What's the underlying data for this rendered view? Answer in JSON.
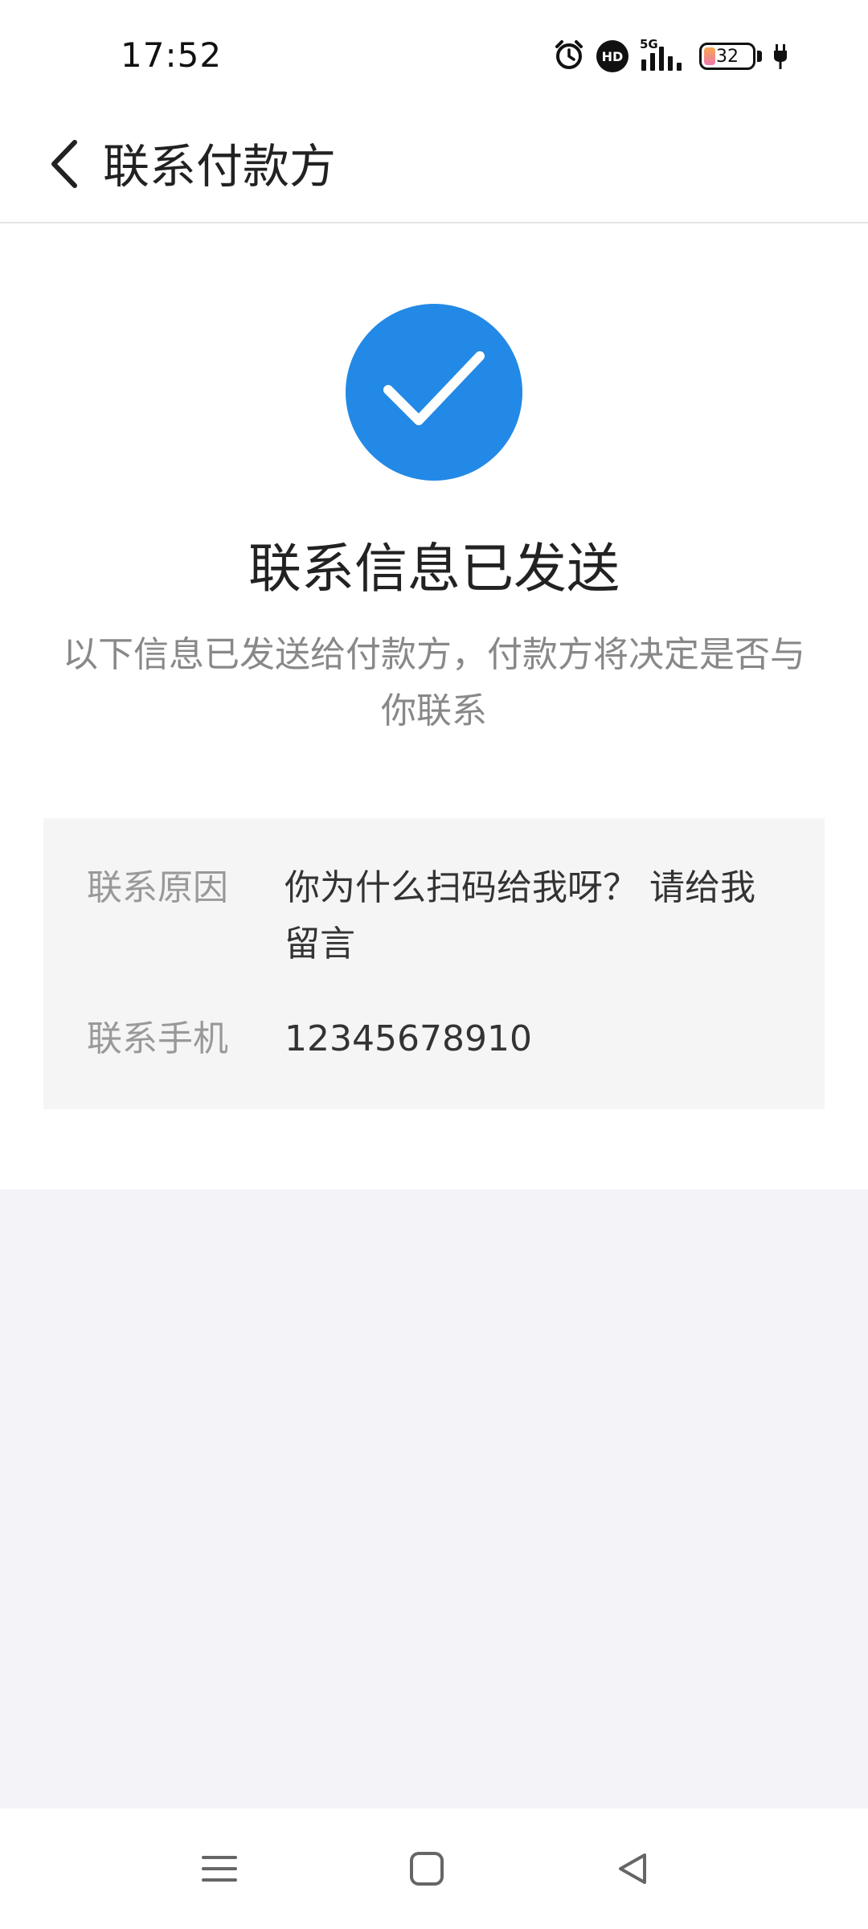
{
  "status_bar": {
    "time": "17:52",
    "network_tag": "5G",
    "hd_label": "HD",
    "battery_level": "32"
  },
  "header": {
    "title": "联系付款方"
  },
  "success": {
    "title": "联系信息已发送",
    "description": "以下信息已发送给付款方，付款方将决定是否与你联系"
  },
  "info": {
    "reason_label": "联系原因",
    "reason_value": "你为什么扫码给我呀？ 请给我留言",
    "phone_label": "联系手机",
    "phone_value": "12345678910"
  },
  "colors": {
    "accent": "#2389e6",
    "card_bg": "#f5f5f5",
    "bottom_bg": "#f3f3f8"
  }
}
